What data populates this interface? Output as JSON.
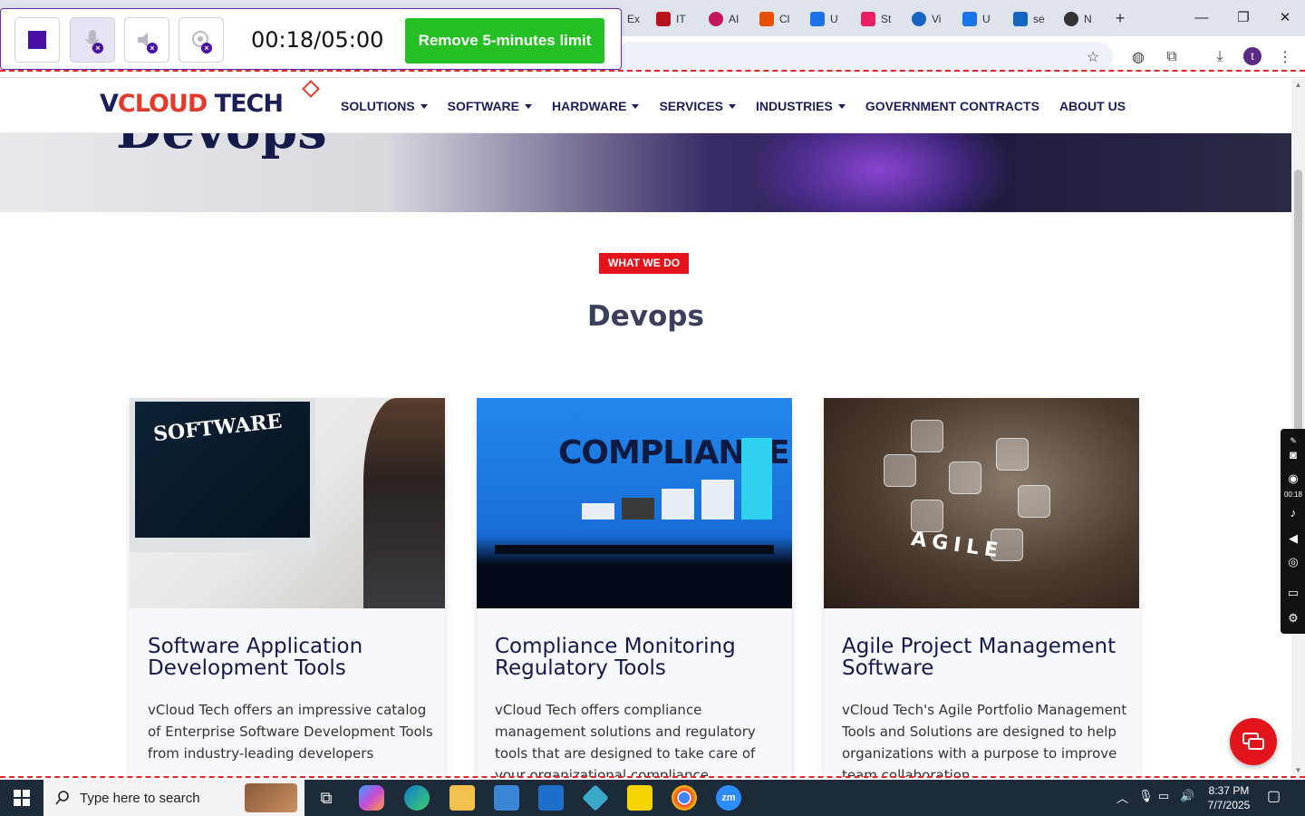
{
  "browser": {
    "tabs": [
      {
        "label": "Ex",
        "color": "#6a6a6a"
      },
      {
        "label": "IT",
        "color": "#b5121b"
      },
      {
        "label": "AI",
        "color": "#c2185b"
      },
      {
        "label": "Cl",
        "color": "#e65100"
      },
      {
        "label": "U",
        "color": "#1a73e8"
      },
      {
        "label": "St",
        "color": "#e91e63"
      },
      {
        "label": "Vi",
        "color": "#1565c0"
      },
      {
        "label": "U",
        "color": "#1a73e8"
      },
      {
        "label": "se",
        "color": "#1565c0"
      },
      {
        "label": "N",
        "color": "#333333"
      }
    ],
    "new_tab_label": "+",
    "minimize": "—",
    "maximize": "❐",
    "close": "✕",
    "profile_initial": "t"
  },
  "recorder": {
    "timer": "00:18/05:00",
    "upgrade_label": "Remove 5-minutes limit",
    "side_time": "00:18"
  },
  "site": {
    "logo_v": "V",
    "logo_cloud": "CLOUD",
    "logo_tech": "TECH",
    "nav": [
      {
        "label": "SOLUTIONS",
        "dropdown": true
      },
      {
        "label": "SOFTWARE",
        "dropdown": true
      },
      {
        "label": "HARDWARE",
        "dropdown": true
      },
      {
        "label": "SERVICES",
        "dropdown": true
      },
      {
        "label": "INDUSTRIES",
        "dropdown": true
      },
      {
        "label": "GOVERNMENT CONTRACTS",
        "dropdown": false
      },
      {
        "label": "ABOUT US",
        "dropdown": false
      }
    ],
    "hero_title": "Devops",
    "badge": "WHAT WE DO",
    "section_title": "Devops",
    "cards": [
      {
        "image_word": "SOFTWARE",
        "title": "Software Application Development Tools",
        "text": "vCloud Tech offers an impressive catalog of Enterprise Software Development Tools from industry-leading developers"
      },
      {
        "image_word": "COMPLIANCE",
        "title": "Compliance Monitoring Regulatory Tools",
        "text": "vCloud Tech offers compliance management solutions and regulatory tools that are designed to take care of your organizational compliance."
      },
      {
        "image_word": "AGILE",
        "title": "Agile Project Management Software",
        "text": "vCloud Tech's Agile Portfolio Management Tools and Solutions are designed to help organizations with a purpose to improve team collaboration."
      }
    ]
  },
  "taskbar": {
    "search_placeholder": "Type here to search",
    "time": "8:37 PM",
    "date": "7/7/2025"
  },
  "colors": {
    "brand_navy": "#1b1e58",
    "brand_red": "#e3141b",
    "recorder_purple": "#4a0fa6",
    "upgrade_green": "#25c023"
  }
}
